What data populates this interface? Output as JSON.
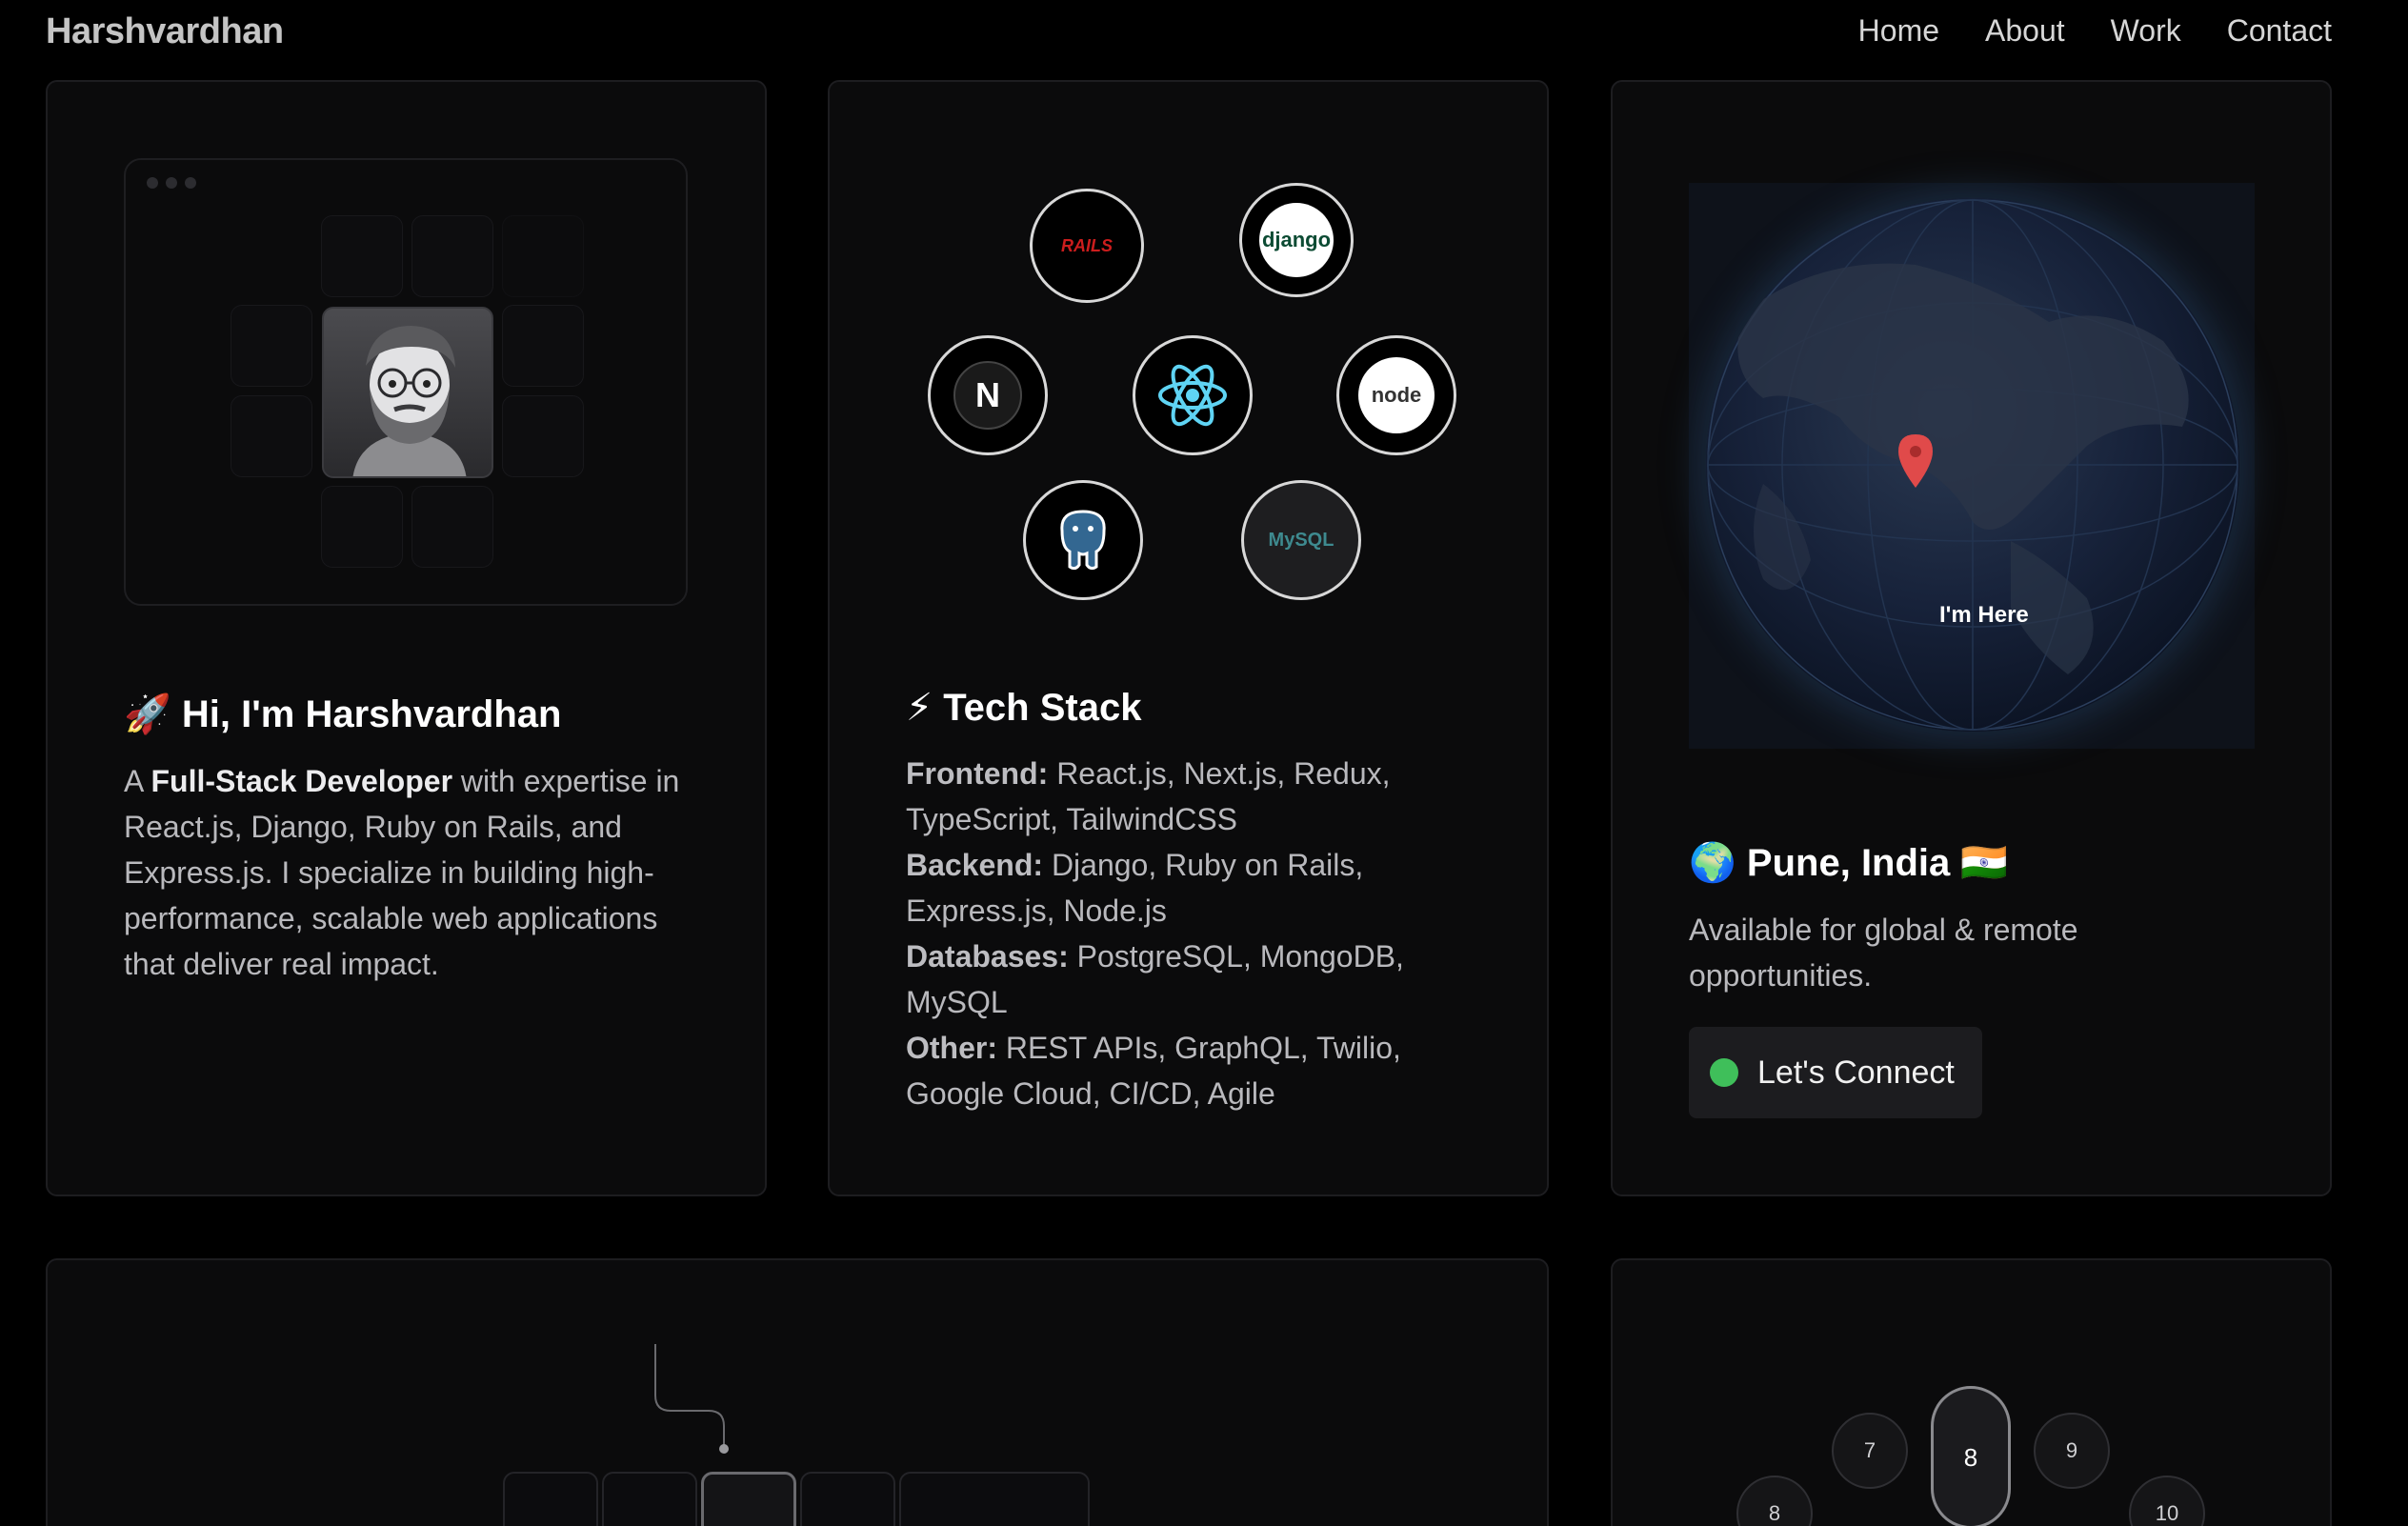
{
  "nav": {
    "logo": "Harshvardhan",
    "links": [
      "Home",
      "About",
      "Work",
      "Contact"
    ]
  },
  "intro": {
    "title": "🚀 Hi, I'm Harshvardhan",
    "desc_a": "A ",
    "desc_bold": "Full-Stack Developer",
    "desc_b": " with expertise in React.js, Django, Ruby on Rails, and Express.js. I specialize in building high-performance, scalable web applications that deliver real impact."
  },
  "tech": {
    "title": "⚡ Tech Stack",
    "logos": {
      "rails": "RAILS",
      "django": "django",
      "next": "N",
      "node": "node",
      "mysql": "MySQL"
    },
    "rows": [
      {
        "label": "Frontend:",
        "value": " React.js, Next.js, Redux, TypeScript, TailwindCSS"
      },
      {
        "label": "Backend:",
        "value": " Django, Ruby on Rails, Express.js, Node.js"
      },
      {
        "label": "Databases:",
        "value": " PostgreSQL, MongoDB, MySQL"
      },
      {
        "label": "Other:",
        "value": " REST APIs, GraphQL, Twilio, Google Cloud, CI/CD, Agile"
      }
    ]
  },
  "location": {
    "marker_label": "I'm Here",
    "title": "🌍 Pune, India 🇮🇳",
    "desc": "Available for global & remote opportunities.",
    "connect": "Let's Connect",
    "status_color": "#3fbf5a"
  },
  "dial": {
    "values": [
      "8",
      "7",
      "8",
      "9",
      "10"
    ]
  }
}
